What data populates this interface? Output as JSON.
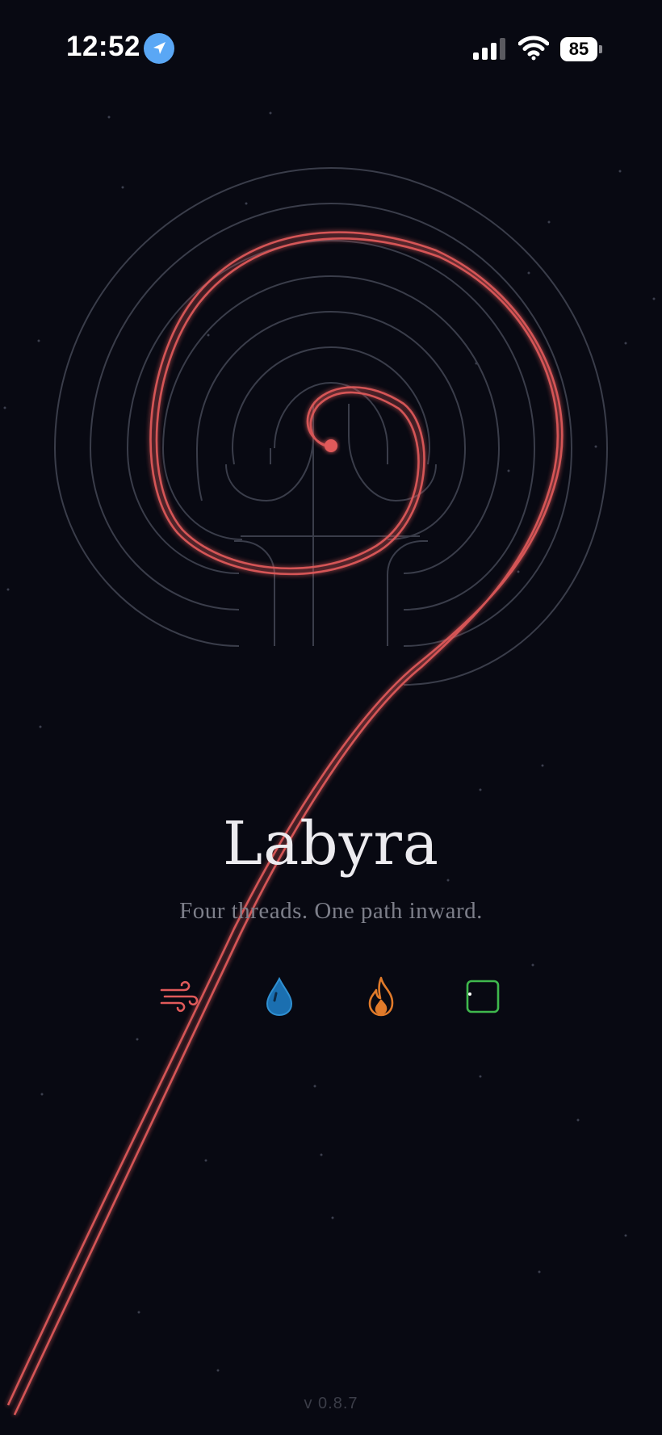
{
  "status_bar": {
    "time": "12:52",
    "battery_level": "85",
    "icons": [
      "location-arrow-icon",
      "cellular-signal-icon",
      "wifi-icon",
      "battery-icon"
    ]
  },
  "splash": {
    "title": "Labyra",
    "tagline": "Four threads. One path inward.",
    "version": "v 0.8.7"
  },
  "threads": [
    {
      "name": "wind-icon",
      "color": "#e05a5a"
    },
    {
      "name": "water-drop-icon",
      "color": "#2f8fd1"
    },
    {
      "name": "flame-icon",
      "color": "#e07a2a"
    },
    {
      "name": "earth-square-icon",
      "color": "#3fb84d"
    }
  ],
  "colors": {
    "background": "#080912",
    "thread_red": "#e05a5a",
    "labyrinth_lines": "#3a3d4a"
  }
}
